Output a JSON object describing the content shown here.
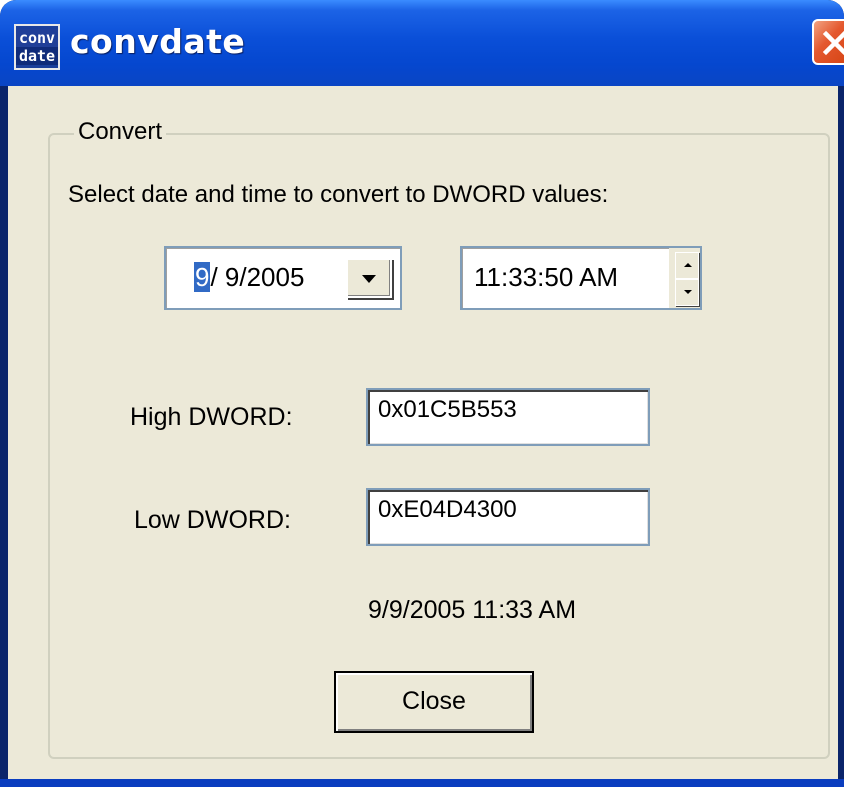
{
  "window": {
    "title": "convdate",
    "icon_text_top": "conv",
    "icon_text_bottom": "date",
    "close_icon": "close-x-icon"
  },
  "group": {
    "label": "Convert",
    "instruction": "Select date and time to convert to DWORD values:"
  },
  "date_picker": {
    "selected_part": "9",
    "rest": "/  9/2005",
    "dropdown_icon": "chevron-down-icon"
  },
  "time_picker": {
    "value": "11:33:50 AM",
    "up_icon": "spin-up-icon",
    "down_icon": "spin-down-icon"
  },
  "high_dword": {
    "label": "High DWORD:",
    "value": "0x01C5B553"
  },
  "low_dword": {
    "label": "Low DWORD:",
    "value": "0xE04D4300"
  },
  "result_text": "9/9/2005 11:33 AM",
  "buttons": {
    "close_label": "Close"
  },
  "colors": {
    "titlebar": "#0A4FD8",
    "dialog_bg": "#ECE9D8",
    "close_button": "#E4582E",
    "selection": "#316AC5"
  }
}
